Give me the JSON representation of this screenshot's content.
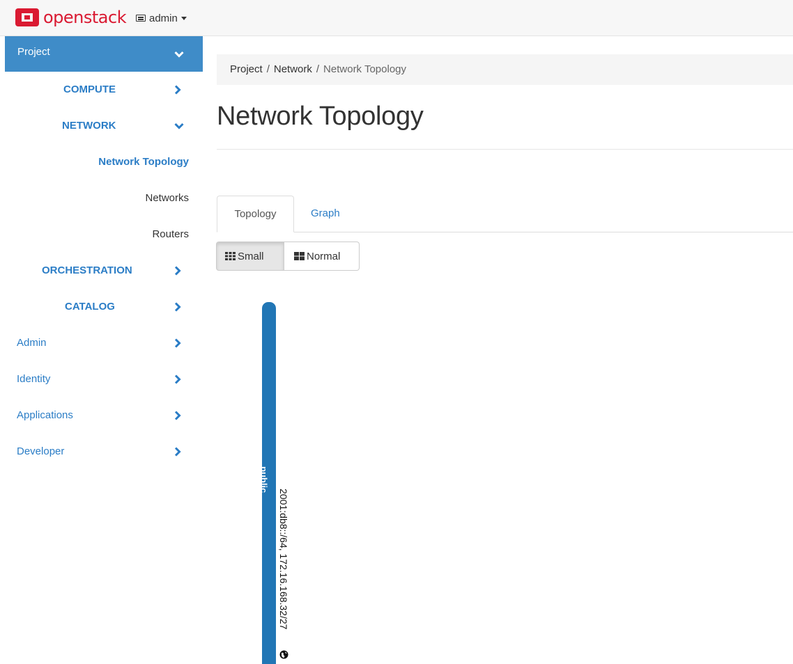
{
  "navbar": {
    "brand": "openstack",
    "project_selector": "admin"
  },
  "sidebar": {
    "project": "Project",
    "compute": "COMPUTE",
    "network": "NETWORK",
    "network_topology": "Network Topology",
    "networks": "Networks",
    "routers": "Routers",
    "orchestration": "ORCHESTRATION",
    "catalog": "CATALOG",
    "admin": "Admin",
    "identity": "Identity",
    "applications": "Applications",
    "developer": "Developer"
  },
  "breadcrumb": {
    "items": [
      "Project",
      "Network",
      "Network Topology"
    ]
  },
  "page": {
    "title": "Network Topology"
  },
  "tabs": {
    "topology": "Topology",
    "graph": "Graph"
  },
  "view_toggle": {
    "small": "Small",
    "normal": "Normal",
    "selected": "Small"
  },
  "topology": {
    "network_name": "public",
    "network_cidr": "2001:db8::/64, 172.16.168.32/27",
    "network_color": "#2176b5"
  },
  "colors": {
    "accent": "#3f8cc8",
    "link": "#2b7dc6",
    "brand": "#da1a32"
  }
}
